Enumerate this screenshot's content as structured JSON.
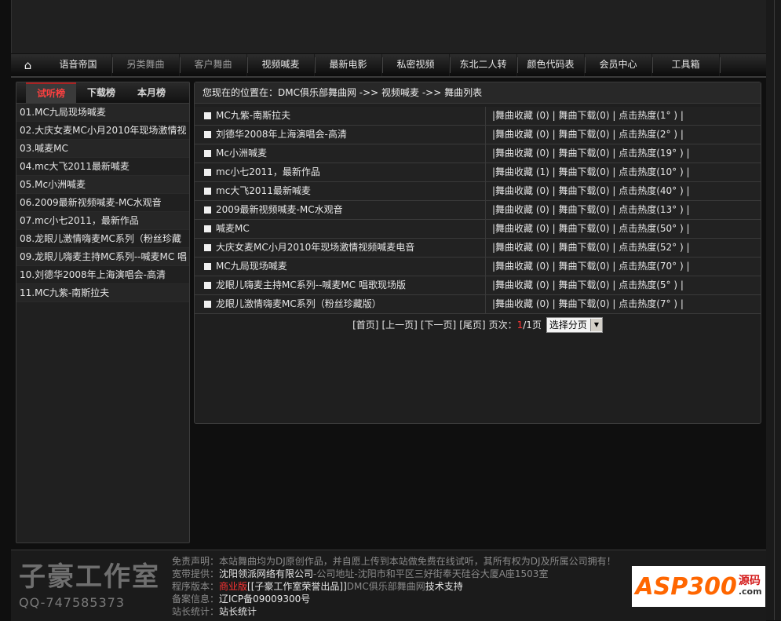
{
  "nav": {
    "items": [
      "语音帝国",
      "另类舞曲",
      "客户舞曲",
      "视频喊麦",
      "最新电影",
      "私密视频",
      "东北二人转",
      "颜色代码表",
      "会员中心",
      "工具箱"
    ]
  },
  "sidebar": {
    "tabs": [
      "试听榜",
      "下载榜",
      "本月榜"
    ],
    "items": [
      "01.MC九局现场喊麦",
      "02.大庆女麦MC小月2010年现场激情视",
      "03.喊麦MC",
      "04.mc大飞2011最新喊麦",
      "05.Mc小洲喊麦",
      "06.2009最新视频喊麦-MC水观音",
      "07.mc小七2011，最新作品",
      "08.龙眼儿激情嗨麦MC系列（粉丝珍藏",
      "09.龙眼儿嗨麦主持MC系列--喊麦MC 唱",
      "10.刘德华2008年上海演唱会-高清",
      "11.MC九紫-南斯拉夫"
    ]
  },
  "main": {
    "breadcrumb": "您现在的位置在：DMC俱乐部舞曲网 ->> 视频喊麦 ->> 舞曲列表",
    "rows": [
      {
        "name": "MC九紫-南斯拉夫",
        "meta": "|舞曲收藏 (0) | 舞曲下载(0) | 点击热度(1°  ) |"
      },
      {
        "name": "刘德华2008年上海演唱会-高清",
        "meta": "|舞曲收藏 (0) | 舞曲下载(0) | 点击热度(2°  ) |"
      },
      {
        "name": "Mc小洲喊麦",
        "meta": "|舞曲收藏 (0) | 舞曲下载(0) | 点击热度(19° ) |"
      },
      {
        "name": "mc小七2011，最新作品",
        "meta": "|舞曲收藏 (1) | 舞曲下载(0) | 点击热度(10° ) |"
      },
      {
        "name": "mc大飞2011最新喊麦",
        "meta": "|舞曲收藏 (0) | 舞曲下载(0) | 点击热度(40° ) |"
      },
      {
        "name": "2009最新视频喊麦-MC水观音",
        "meta": "|舞曲收藏 (0) | 舞曲下载(0) | 点击热度(13° ) |"
      },
      {
        "name": "喊麦MC",
        "meta": "|舞曲收藏 (0) | 舞曲下载(0) | 点击热度(50° ) |"
      },
      {
        "name": "大庆女麦MC小月2010年现场激情视频喊麦电音",
        "meta": "|舞曲收藏 (0) | 舞曲下载(0) | 点击热度(52° ) |"
      },
      {
        "name": "MC九局现场喊麦",
        "meta": "|舞曲收藏 (0) | 舞曲下载(0) | 点击热度(70° ) |"
      },
      {
        "name": "龙眼儿嗨麦主持MC系列--喊麦MC 唱歌现场版",
        "meta": "|舞曲收藏 (0) | 舞曲下载(0) | 点击热度(5°  ) |"
      },
      {
        "name": "龙眼儿激情嗨麦MC系列（粉丝珍藏版）",
        "meta": "|舞曲收藏 (0) | 舞曲下载(0) | 点击热度(7°  ) |"
      }
    ],
    "pager": {
      "first": "[首页]",
      "prev": "[上一页]",
      "next": "[下一页]",
      "last": "[尾页]",
      "label": "页次：",
      "current": "1",
      "total": "/1页",
      "select": "选择分页"
    }
  },
  "footer": {
    "logo_title": "子豪工作室",
    "logo_qq": "QQ-747585373",
    "disclaimer_k": "免责声明：",
    "disclaimer_v": "本站舞曲均为DJ原创作品，并自愿上传到本站做免费在线试听，其所有权为DJ及所属公司拥有！",
    "bandwidth_k": "宽带提供：",
    "bandwidth_v": "沈阳领派网络有限公司",
    "address": "-公司地址-沈阳市和平区三好街奉天硅谷大厦A座1503室",
    "version_k": "程序版本：",
    "version_red": "商业版",
    "version_v": "[[子豪工作室荣誉出品]]",
    "version_site": "DMC俱乐部舞曲网",
    "version_tail": "技术支持",
    "icp_k": "备案信息：",
    "icp_v": "辽ICP备09009300号",
    "stat_k": "站长统计：",
    "stat_v": "站长统计",
    "partner_text": "ASP300",
    "partner_tag": "源码",
    "partner_sub": ".com"
  },
  "colors": {
    "accent_red": "#ff3333",
    "partner_orange": "#ff6600"
  }
}
